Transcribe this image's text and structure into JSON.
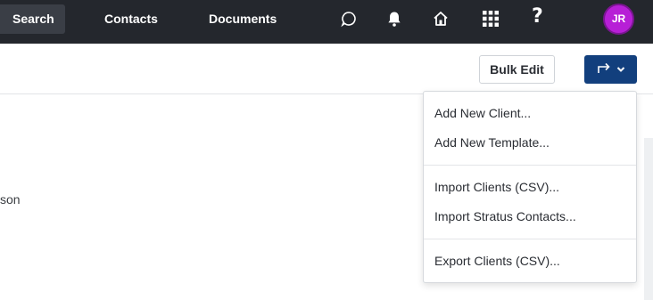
{
  "nav": {
    "search_label": "Search",
    "contacts_label": "Contacts",
    "documents_label": "Documents",
    "help_label": "?",
    "avatar_initials": "JR",
    "icons": [
      "chat-icon",
      "bell-icon",
      "home-icon",
      "apps-grid-icon",
      "help-icon"
    ]
  },
  "toolbar": {
    "bulk_edit_label": "Bulk Edit",
    "action_button_icons": [
      "share-arrow-icon",
      "chevron-down-icon"
    ]
  },
  "content": {
    "partial_text": "son"
  },
  "menu": {
    "items": [
      {
        "label": "Add New Client..."
      },
      {
        "label": "Add New Template..."
      },
      {
        "label": "Import Clients (CSV)..."
      },
      {
        "label": "Import Stratus Contacts..."
      },
      {
        "label": "Export Clients (CSV)..."
      }
    ]
  },
  "colors": {
    "nav_bg": "#24272d",
    "accent_button": "#123f7d",
    "avatar": "#b71fd6"
  }
}
